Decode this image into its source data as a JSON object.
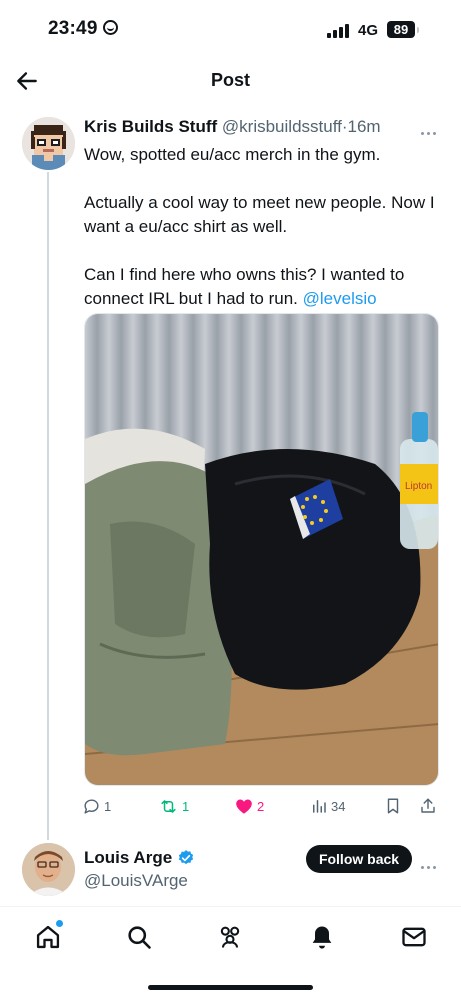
{
  "status_bar": {
    "time": "23:49",
    "network": "4G",
    "battery": "89"
  },
  "header": {
    "title": "Post"
  },
  "tweet": {
    "display_name": "Kris Builds Stuff",
    "handle": "@krisbuildsstuff",
    "separator": "·",
    "time": "16m",
    "text_line1": "Wow, spotted eu/acc merch in the gym.",
    "text_para2": "Actually a cool way to meet new people. Now I want a eu/acc shirt as well.",
    "text_para3_prefix": "Can I find here who owns this? I wanted to connect IRL but I had to run. ",
    "mention": "@levelsio",
    "bottle_brand": "Lipton",
    "metrics": {
      "replies": "1",
      "reposts": "1",
      "likes": "2",
      "views": "34"
    },
    "colors": {
      "link": "#1d9bf0",
      "repost": "#00ba7c",
      "like": "#f91880"
    }
  },
  "reply_user": {
    "display_name": "Louis Arge",
    "handle": "@LouisVArge",
    "verified": true,
    "follow_label": "Follow back"
  },
  "bottom_nav": {
    "items": [
      "home-icon",
      "search-icon",
      "communities-icon",
      "notifications-icon",
      "messages-icon"
    ],
    "home_has_badge": true
  }
}
